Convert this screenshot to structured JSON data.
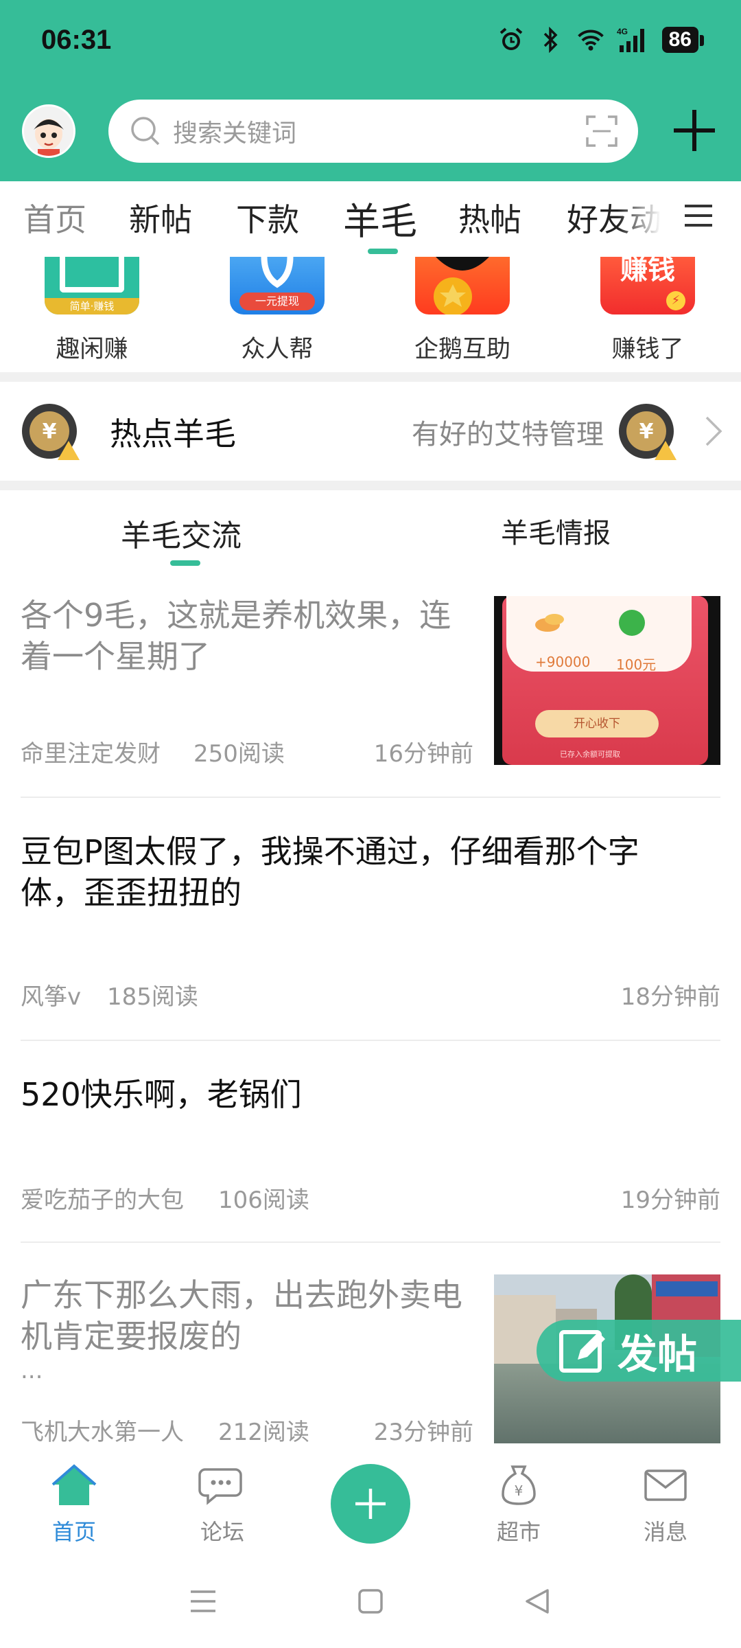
{
  "status_bar": {
    "time": "06:31",
    "battery": "86",
    "network": "4G"
  },
  "header": {
    "search_placeholder": "搜索关键词"
  },
  "nav_tabs": [
    "首页",
    "新帖",
    "下款",
    "羊毛",
    "热帖",
    "好友动"
  ],
  "nav_active": "羊毛",
  "apps": [
    {
      "name": "趣闲赚",
      "logo_text": "简单·赚钱"
    },
    {
      "name": "众人帮",
      "logo_text": "一元提现"
    },
    {
      "name": "企鹅互助",
      "logo_text": ""
    },
    {
      "name": "赚钱了",
      "logo_text": "赚钱"
    }
  ],
  "hot": {
    "title": "热点羊毛",
    "user": "有好的艾特管理"
  },
  "sub_tabs": [
    "羊毛交流",
    "羊毛情报"
  ],
  "posts": [
    {
      "title": "各个9毛，这就是养机效果，连着一个星期了",
      "author": "命里注定发财",
      "reads": "250阅读",
      "time": "16分钟前",
      "read": true,
      "thumb": "red-packet",
      "thumb_texts": [
        "+90000",
        "100元",
        "开心收下",
        "已存入余额可提取"
      ]
    },
    {
      "title": "豆包P图太假了，我操不通过，仔细看那个字体，歪歪扭扭的",
      "author": "风筝v",
      "reads": "185阅读",
      "time": "18分钟前",
      "read": false
    },
    {
      "title": "520快乐啊，老锅们",
      "author": "爱吃茄子的大包",
      "reads": "106阅读",
      "time": "19分钟前",
      "read": false
    },
    {
      "title": "广东下那么大雨，出去跑外卖电机肯定要报废的",
      "ellipsis": "...",
      "author": "飞机大水第一人",
      "reads": "212阅读",
      "time": "23分钟前",
      "read": true,
      "thumb": "flood-street"
    }
  ],
  "fab": {
    "label": "发帖"
  },
  "bottom_nav": [
    {
      "label": "首页",
      "icon": "home-icon",
      "active": true
    },
    {
      "label": "论坛",
      "icon": "chat-icon",
      "active": false
    },
    {
      "label": "超市",
      "icon": "money-bag-icon",
      "active": false
    },
    {
      "label": "消息",
      "icon": "mail-icon",
      "active": false
    }
  ],
  "colors": {
    "brand": "#36bd98",
    "active_blue": "#2f8bd8"
  }
}
